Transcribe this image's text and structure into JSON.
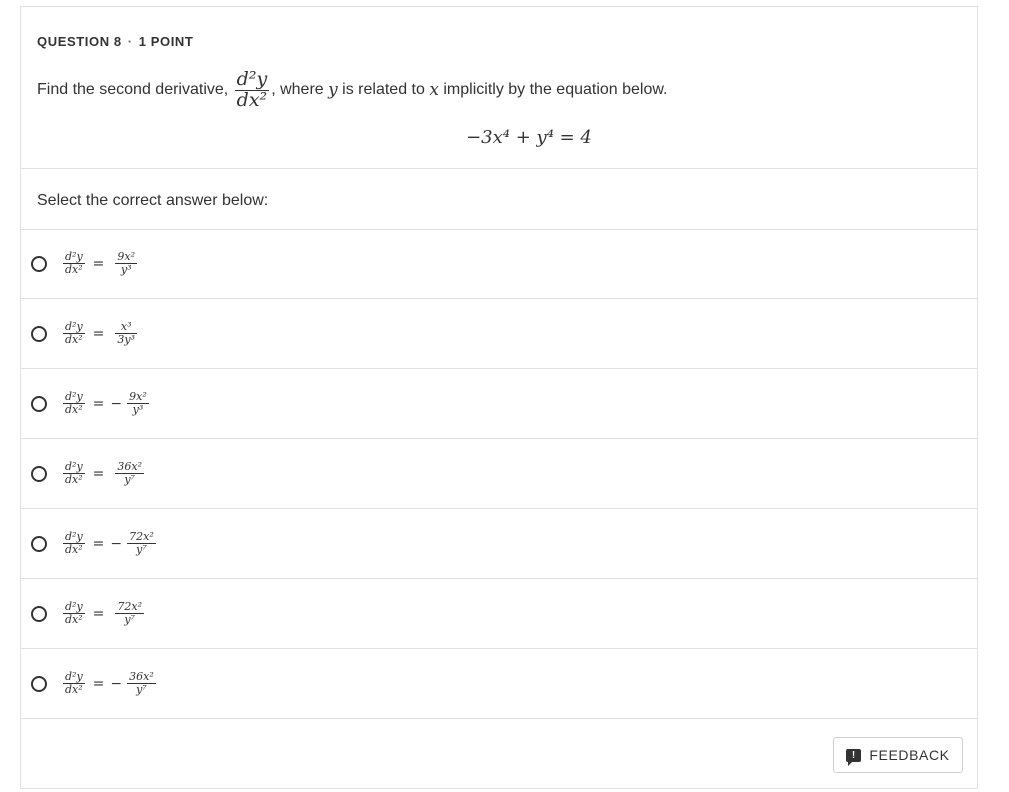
{
  "header": {
    "question_label": "QUESTION 8",
    "separator": "·",
    "points_label": "1 POINT"
  },
  "prompt": {
    "text_before": "Find the second derivative,",
    "deriv_num": "d²y",
    "deriv_den": "dx²",
    "text_comma": ",",
    "text_where": " where ",
    "var_y": "y",
    "text_related": " is related to ",
    "var_x": "x",
    "text_after": " implicitly by the equation below."
  },
  "equation": "−3x⁴ + y⁴ = 4",
  "select_label": "Select the correct answer below:",
  "options": [
    {
      "lhs_num": "d²y",
      "lhs_den": "dx²",
      "eq": "=",
      "sign": "",
      "rhs_num": "9x²",
      "rhs_den": "y³"
    },
    {
      "lhs_num": "d²y",
      "lhs_den": "dx²",
      "eq": "=",
      "sign": "",
      "rhs_num": "x³",
      "rhs_den": "3y³"
    },
    {
      "lhs_num": "d²y",
      "lhs_den": "dx²",
      "eq": "=",
      "sign": "−",
      "rhs_num": "9x²",
      "rhs_den": "y³"
    },
    {
      "lhs_num": "d²y",
      "lhs_den": "dx²",
      "eq": "=",
      "sign": "",
      "rhs_num": "36x²",
      "rhs_den": "y⁷"
    },
    {
      "lhs_num": "d²y",
      "lhs_den": "dx²",
      "eq": "=",
      "sign": "−",
      "rhs_num": "72x²",
      "rhs_den": "y⁷"
    },
    {
      "lhs_num": "d²y",
      "lhs_den": "dx²",
      "eq": "=",
      "sign": "",
      "rhs_num": "72x²",
      "rhs_den": "y⁷"
    },
    {
      "lhs_num": "d²y",
      "lhs_den": "dx²",
      "eq": "=",
      "sign": "−",
      "rhs_num": "36x²",
      "rhs_den": "y⁷"
    }
  ],
  "feedback": {
    "icon": "feedback-icon",
    "icon_glyph": "!",
    "label": "FEEDBACK"
  }
}
